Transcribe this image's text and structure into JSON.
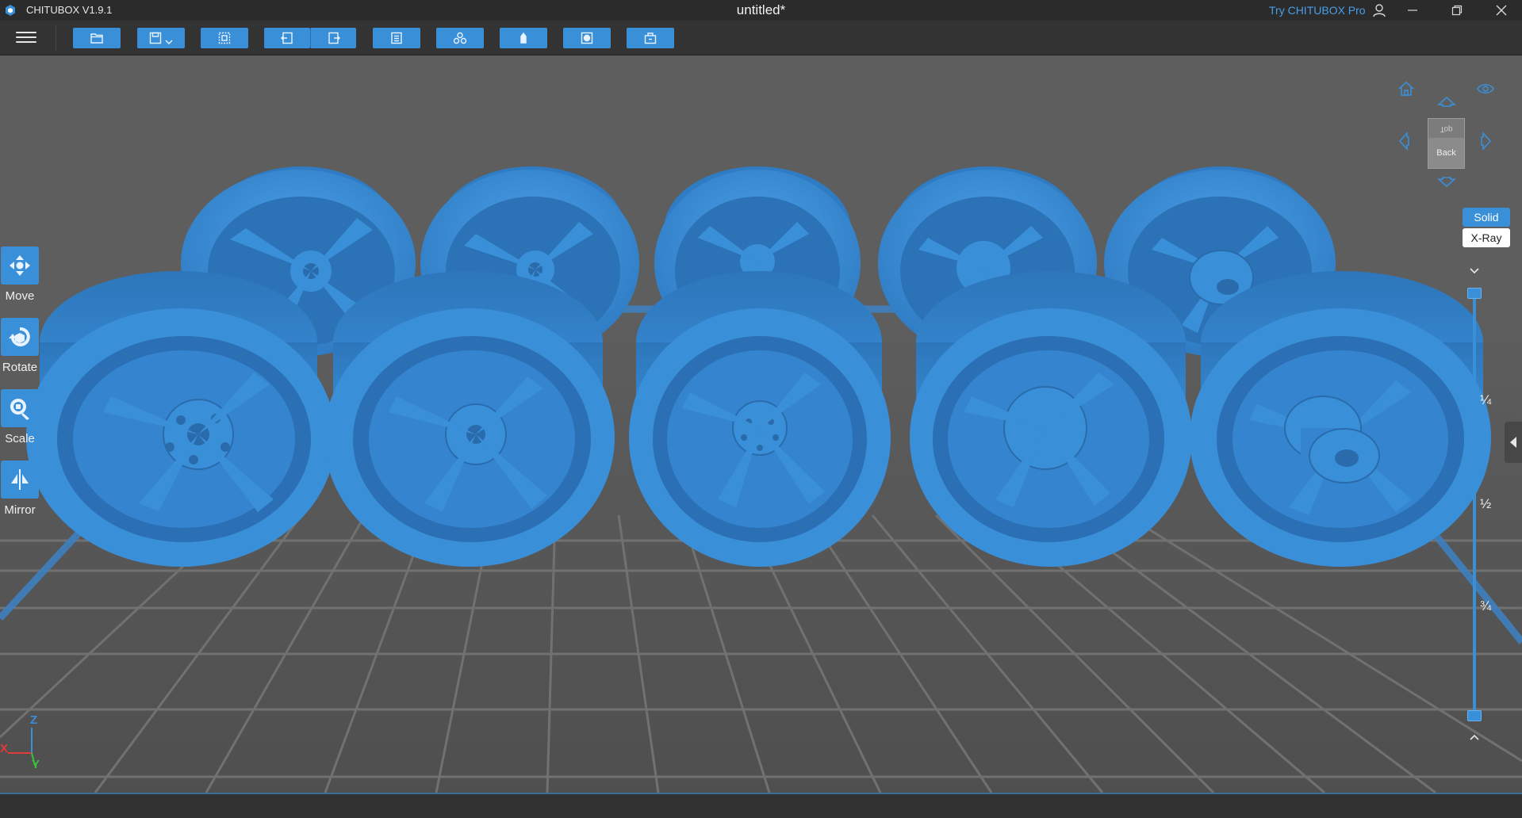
{
  "titlebar": {
    "app_name": "CHITUBOX V1.9.1",
    "document": "untitled*",
    "pro_link": "Try CHITUBOX Pro",
    "icons": [
      "chitubox-logo-icon",
      "user-icon",
      "minimize-icon",
      "restore-icon",
      "close-icon"
    ]
  },
  "toolbar": {
    "icons": [
      "menu-icon",
      "open-file-icon",
      "save-icon",
      "chevron-down-icon",
      "select-all-icon",
      "undo-icon",
      "redo-icon",
      "model-list-icon",
      "auto-layout-icon",
      "support-icon",
      "hollow-icon",
      "slice-icon"
    ]
  },
  "left_tools": [
    {
      "label": "Move",
      "icon": "move-icon"
    },
    {
      "label": "Rotate",
      "icon": "rotate-icon"
    },
    {
      "label": "Scale",
      "icon": "scale-icon"
    },
    {
      "label": "Mirror",
      "icon": "mirror-icon"
    }
  ],
  "view_cube": {
    "top_label": "Top",
    "back_label": "Back",
    "icons": [
      "home-view-icon",
      "view-up-icon",
      "eye-icon",
      "view-left-icon",
      "view-right-icon",
      "view-down-icon"
    ]
  },
  "render_mode": {
    "options": [
      "Solid",
      "X-Ray"
    ],
    "selected": "Solid"
  },
  "layer_slider": {
    "ticks": [
      "¼",
      "½",
      "¾"
    ],
    "top_position": 0,
    "bottom_position": 1
  },
  "axes": {
    "z": "Z",
    "x": "X",
    "y": "Y"
  },
  "scene": {
    "model_count": 10,
    "model_color": "#3a8fd9",
    "background_color": "#5e5e5e",
    "grid_color": "#717171",
    "platform_color": "#3f7fbf"
  },
  "colors": {
    "accent": "#3a8fd9",
    "axis_x": "#e23b3b",
    "axis_y": "#39c23b",
    "axis_z": "#3a8fd9"
  }
}
